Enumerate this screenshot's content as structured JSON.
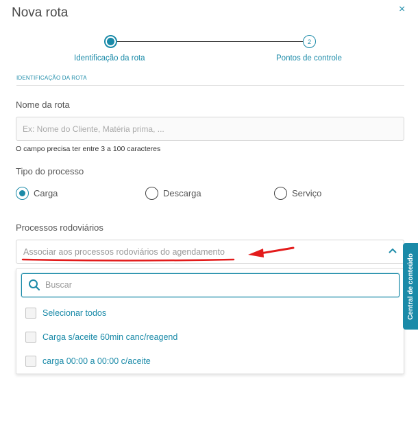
{
  "modal": {
    "title": "Nova rota",
    "close_icon": "×"
  },
  "stepper": {
    "steps": [
      {
        "label": "Identificação da rota",
        "number": "1",
        "state": "active"
      },
      {
        "label": "Pontos de controle",
        "number": "2",
        "state": "pending"
      }
    ]
  },
  "section": {
    "header": "IDENTIFICAÇÃO DA ROTA"
  },
  "route_name": {
    "label": "Nome da rota",
    "placeholder": "Ex: Nome do Cliente, Matéria prima, ...",
    "value": "",
    "hint": "O campo precisa ter entre 3 a 100 caracteres"
  },
  "process_type": {
    "label": "Tipo do processo",
    "options": [
      {
        "label": "Carga",
        "checked": true
      },
      {
        "label": "Descarga",
        "checked": false
      },
      {
        "label": "Serviço",
        "checked": false
      }
    ]
  },
  "road_processes": {
    "label": "Processos rodoviários",
    "placeholder": "Associar aos processos rodoviários do agendamento",
    "search_placeholder": "Buscar",
    "options": [
      {
        "label": "Selecionar todos",
        "checked": false
      },
      {
        "label": "Carga s/aceite 60min canc/reagend",
        "checked": false
      },
      {
        "label": "carga 00:00 a 00:00 c/aceite",
        "checked": false
      }
    ]
  },
  "side_tab": {
    "label": "Central de conteúdo"
  },
  "colors": {
    "accent": "#1a8aa8",
    "annotation": "#e31b1b"
  },
  "icons": {
    "close": "close-icon",
    "chevron": "chevron-up-icon",
    "search": "search-icon"
  }
}
